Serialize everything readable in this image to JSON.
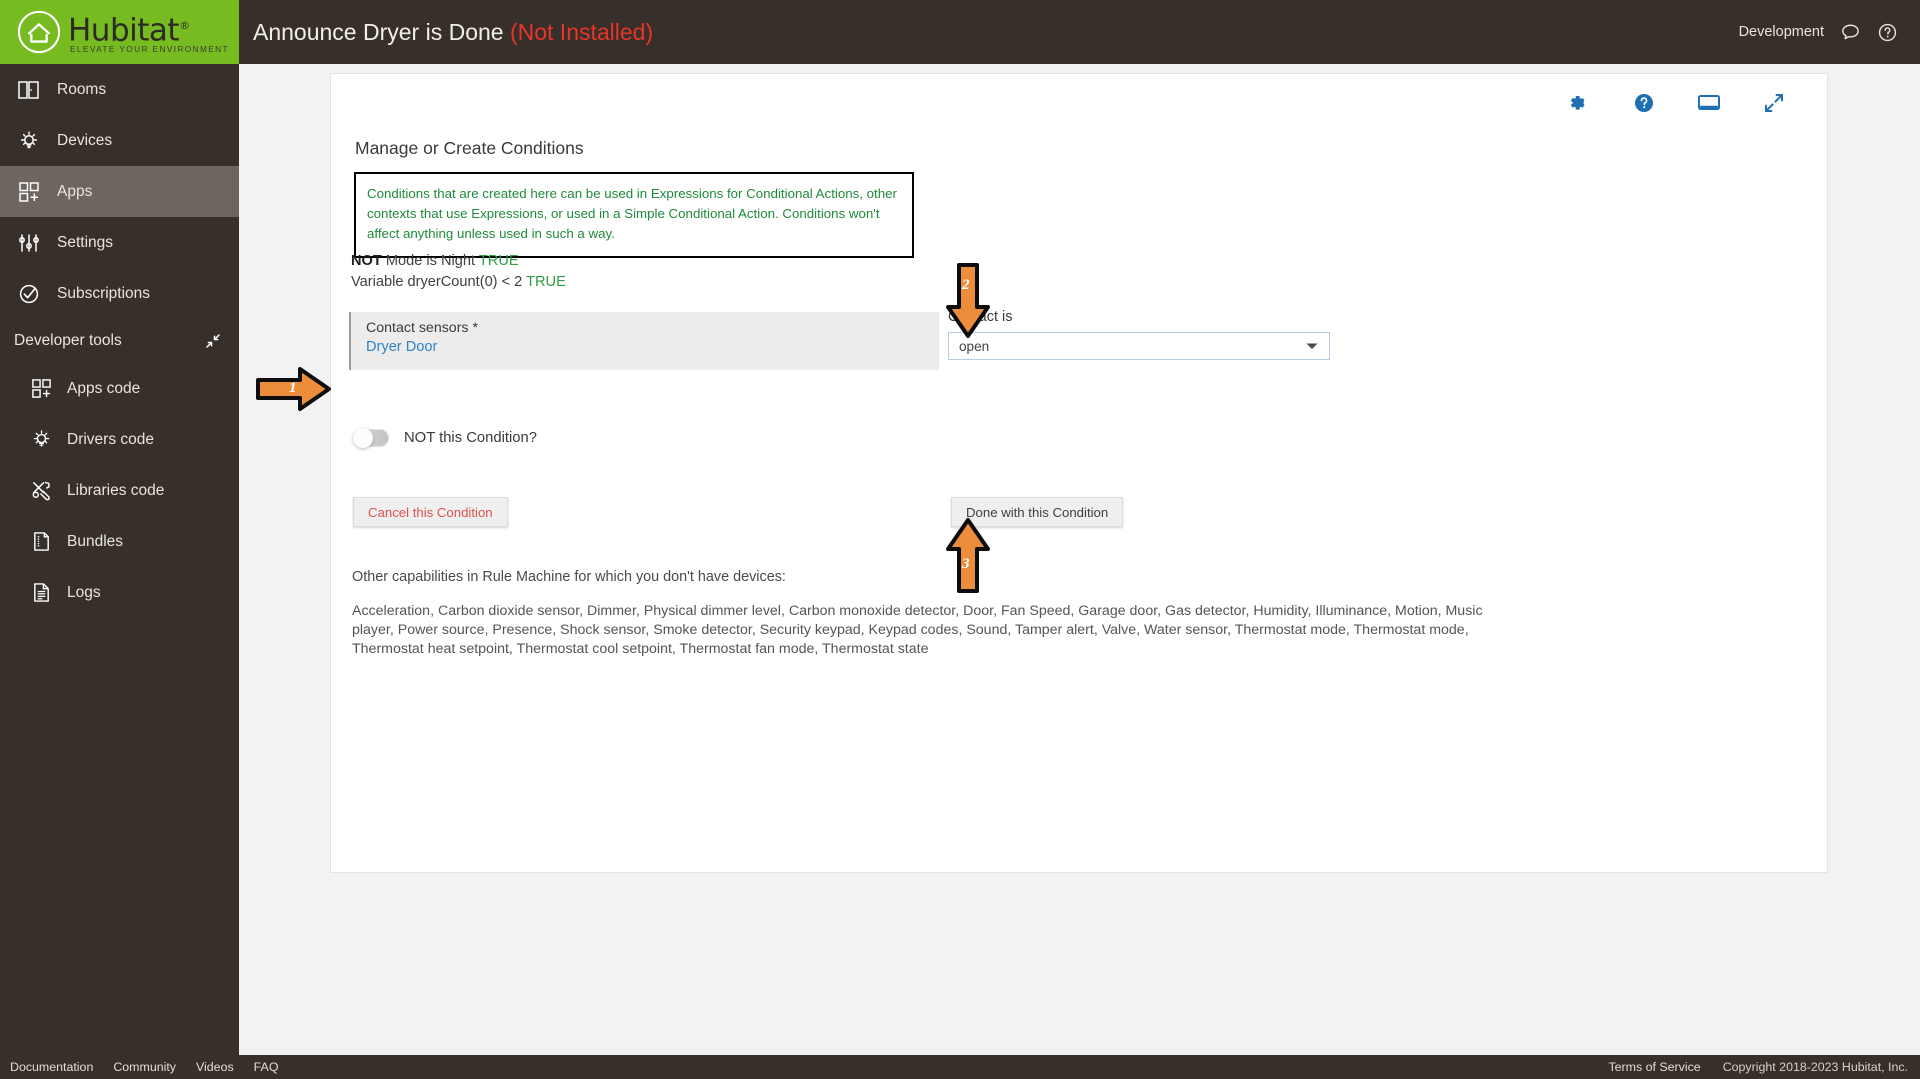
{
  "brand": {
    "name": "Hubitat",
    "registered": "®",
    "tagline": "ELEVATE YOUR ENVIRONMENT",
    "green": "#76bc21",
    "dark": "#372f2a"
  },
  "topbar": {
    "title": "Announce Dryer is Done",
    "status": "(Not Installed)",
    "status_color": "#e8342a",
    "hub_name": "Development",
    "chat_icon": "chat-bubble-icon",
    "help_icon": "help-circle-icon"
  },
  "sidebar": {
    "items": [
      {
        "label": "Rooms",
        "icon": "rooms-icon",
        "active": false
      },
      {
        "label": "Devices",
        "icon": "device-bulb-icon",
        "active": false
      },
      {
        "label": "Apps",
        "icon": "apps-grid-icon",
        "active": true
      },
      {
        "label": "Settings",
        "icon": "sliders-icon",
        "active": false
      },
      {
        "label": "Subscriptions",
        "icon": "check-circle-icon",
        "active": false
      }
    ],
    "section": {
      "label": "Developer tools",
      "collapse_icon": "collapse-arrows-icon"
    },
    "dev_items": [
      {
        "label": "Apps code",
        "icon": "apps-grid-icon"
      },
      {
        "label": "Drivers code",
        "icon": "device-bulb-icon"
      },
      {
        "label": "Libraries code",
        "icon": "tools-icon"
      },
      {
        "label": "Bundles",
        "icon": "bundle-file-icon"
      },
      {
        "label": "Logs",
        "icon": "logs-file-icon"
      }
    ]
  },
  "card": {
    "icons": [
      {
        "name": "gear-icon"
      },
      {
        "name": "help-circle-icon"
      },
      {
        "name": "monitor-icon"
      },
      {
        "name": "expand-arrows-icon"
      }
    ],
    "icon_color": "#1f6fb2",
    "section_title": "Manage or Create Conditions",
    "note": "Conditions that are created here can be used in Expressions for Conditional Actions, other contexts that use Expressions, or used in a Simple Conditional Action.  Conditions won't affect anything unless used in such a way.",
    "note_color": "#1f8a3c",
    "conditions": [
      {
        "prefix": "NOT",
        "text": " Mode is Night ",
        "value": "TRUE"
      },
      {
        "prefix": "",
        "text": "Variable dryerCount(0) < 2 ",
        "value": "TRUE"
      }
    ],
    "true_color": "#2e9b45",
    "sensor_field": {
      "label": "Contact sensors *",
      "value": "Dryer Door",
      "value_color": "#2f83c7"
    },
    "contact_is": {
      "label": "Contact is",
      "selected": "open",
      "caret_icon": "chevron-down-icon"
    },
    "not_condition": {
      "label": "NOT this Condition?",
      "state": "off"
    },
    "cancel_button": "Cancel this Condition",
    "done_button": "Done with this Condition",
    "other_title": "Other capabilities in Rule Machine for which you don't have devices:",
    "other_list": "Acceleration, Carbon dioxide sensor, Dimmer, Physical dimmer level, Carbon monoxide detector, Door, Fan Speed, Garage door, Gas detector, Humidity, Illuminance, Motion, Music player, Power source, Presence, Shock sensor, Smoke detector, Security keypad, Keypad codes, Sound, Tamper alert, Valve, Water sensor, Thermostat mode, Thermostat mode, Thermostat heat setpoint, Thermostat cool setpoint, Thermostat fan mode, Thermostat state"
  },
  "annotations": {
    "color": "#ec8d3c",
    "arrows": [
      {
        "number": "1",
        "direction": "right",
        "target": "contact-sensors-field"
      },
      {
        "number": "2",
        "direction": "down",
        "target": "contact-is-dropdown"
      },
      {
        "number": "3",
        "direction": "up",
        "target": "done-with-this-condition-button"
      }
    ]
  },
  "footer": {
    "links": [
      "Documentation",
      "Community",
      "Videos",
      "FAQ"
    ],
    "terms": "Terms of Service",
    "copyright": "Copyright 2018-2023 Hubitat, Inc."
  }
}
